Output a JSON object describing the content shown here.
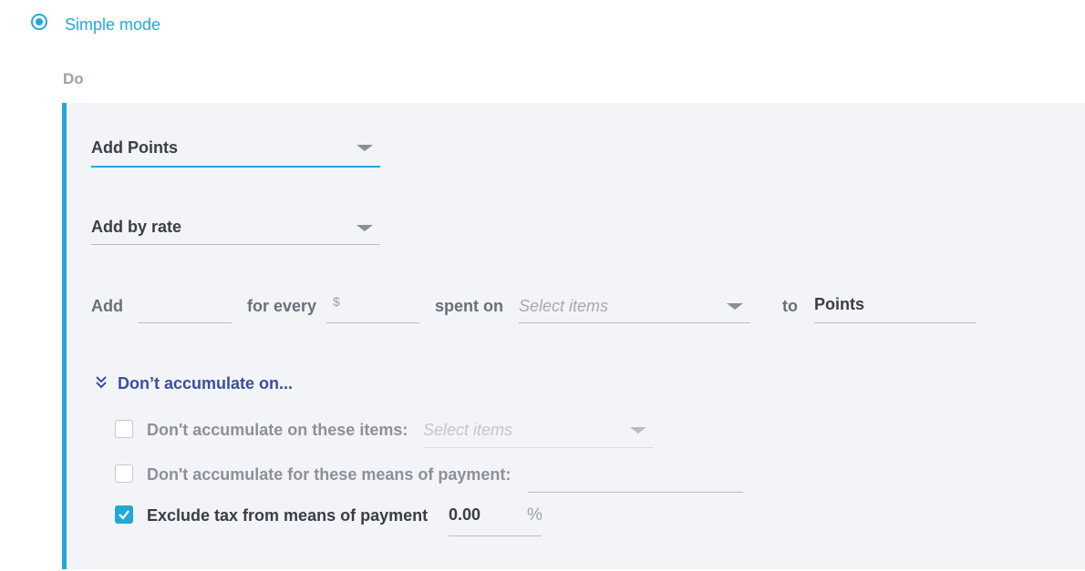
{
  "mode": {
    "label": "Simple mode",
    "selected": true
  },
  "section_label": "Do",
  "action_select": {
    "value": "Add Points"
  },
  "method_select": {
    "value": "Add by rate"
  },
  "rule": {
    "add_label": "Add",
    "add_value": "",
    "for_every_label": "for every",
    "currency_symbol": "$",
    "amount_value": "",
    "spent_on_label": "spent on",
    "items_placeholder": "Select items",
    "to_label": "to",
    "target_value": "Points"
  },
  "exclusions": {
    "toggle_label": "Don’t accumulate on...",
    "items_label": "Don't accumulate on these items:",
    "items_placeholder": "Select items",
    "items_checked": false,
    "payment_label": "Don't accumulate for these means of payment:",
    "payment_checked": false,
    "tax_label": "Exclude tax from means of payment",
    "tax_checked": true,
    "tax_value": "0.00",
    "tax_unit": "%"
  },
  "colors": {
    "accent": "#23a8d6",
    "link": "#3a4fa0",
    "panel_bg": "#f2f4f7"
  }
}
